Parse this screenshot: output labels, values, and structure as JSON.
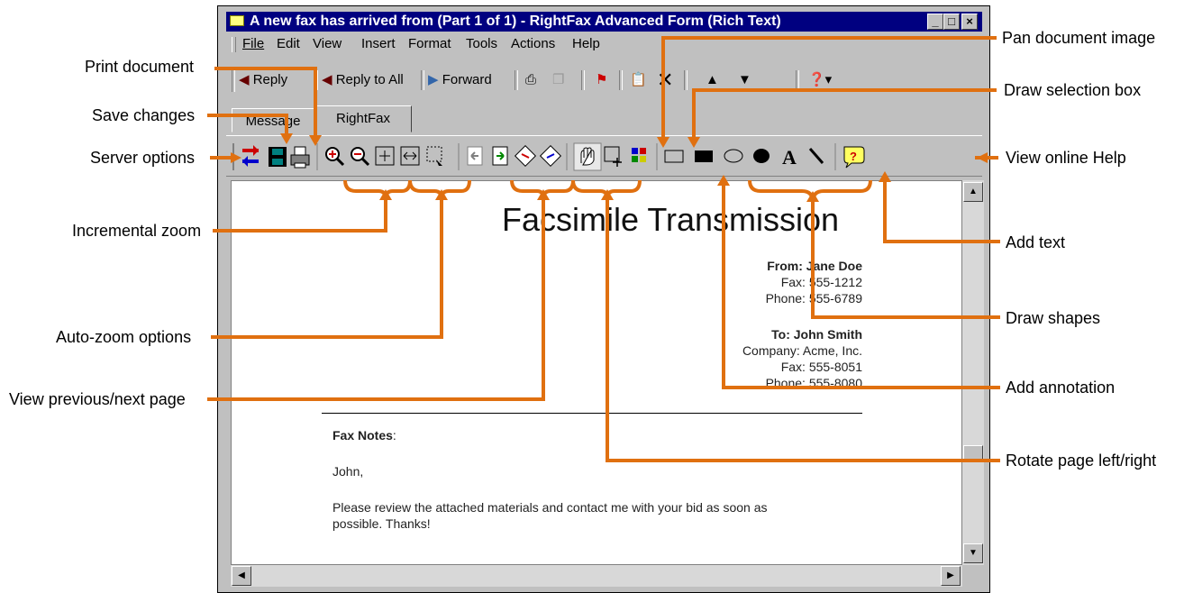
{
  "window": {
    "title": "A new fax has arrived from  (Part 1 of 1) - RightFax Advanced Form (Rich Text)",
    "buttons": [
      "_",
      "□",
      "×"
    ]
  },
  "menu": [
    "File",
    "Edit",
    "View",
    "Insert",
    "Format",
    "Tools",
    "Actions",
    "Help"
  ],
  "toolbar": {
    "reply": "Reply",
    "reply_all": "Reply to All",
    "forward": "Forward"
  },
  "tabs": [
    "Message",
    "RightFax"
  ],
  "callouts": {
    "print_document": "Print document",
    "save_changes": "Save changes",
    "server_options": "Server options",
    "incremental_zoom": "Incremental zoom",
    "auto_zoom": "Auto-zoom options",
    "prev_next": "View previous/next page",
    "pan": "Pan document image",
    "draw_selection": "Draw selection box",
    "view_help": "View online Help",
    "add_text": "Add text",
    "draw_shapes": "Draw shapes",
    "add_annotation": "Add annotation",
    "rotate": "Rotate page left/right"
  },
  "fax": {
    "title": "Facsimile Transmission",
    "from": "From: Jane Doe",
    "from_fax": "Fax: 555-1212",
    "from_phone": "Phone: 555-6789",
    "to": "To: John Smith",
    "company": "Company: Acme, Inc.",
    "to_fax": "Fax: 555-8051",
    "to_phone": "Phone: 555-8080",
    "notes_label": "Fax Notes",
    "greeting": "John,",
    "body1": "Please review the attached materials and contact me with your bid as soon as",
    "body2": "possible. Thanks!"
  },
  "colors": {
    "callout": "#e07010",
    "titlebar": "#000080"
  }
}
